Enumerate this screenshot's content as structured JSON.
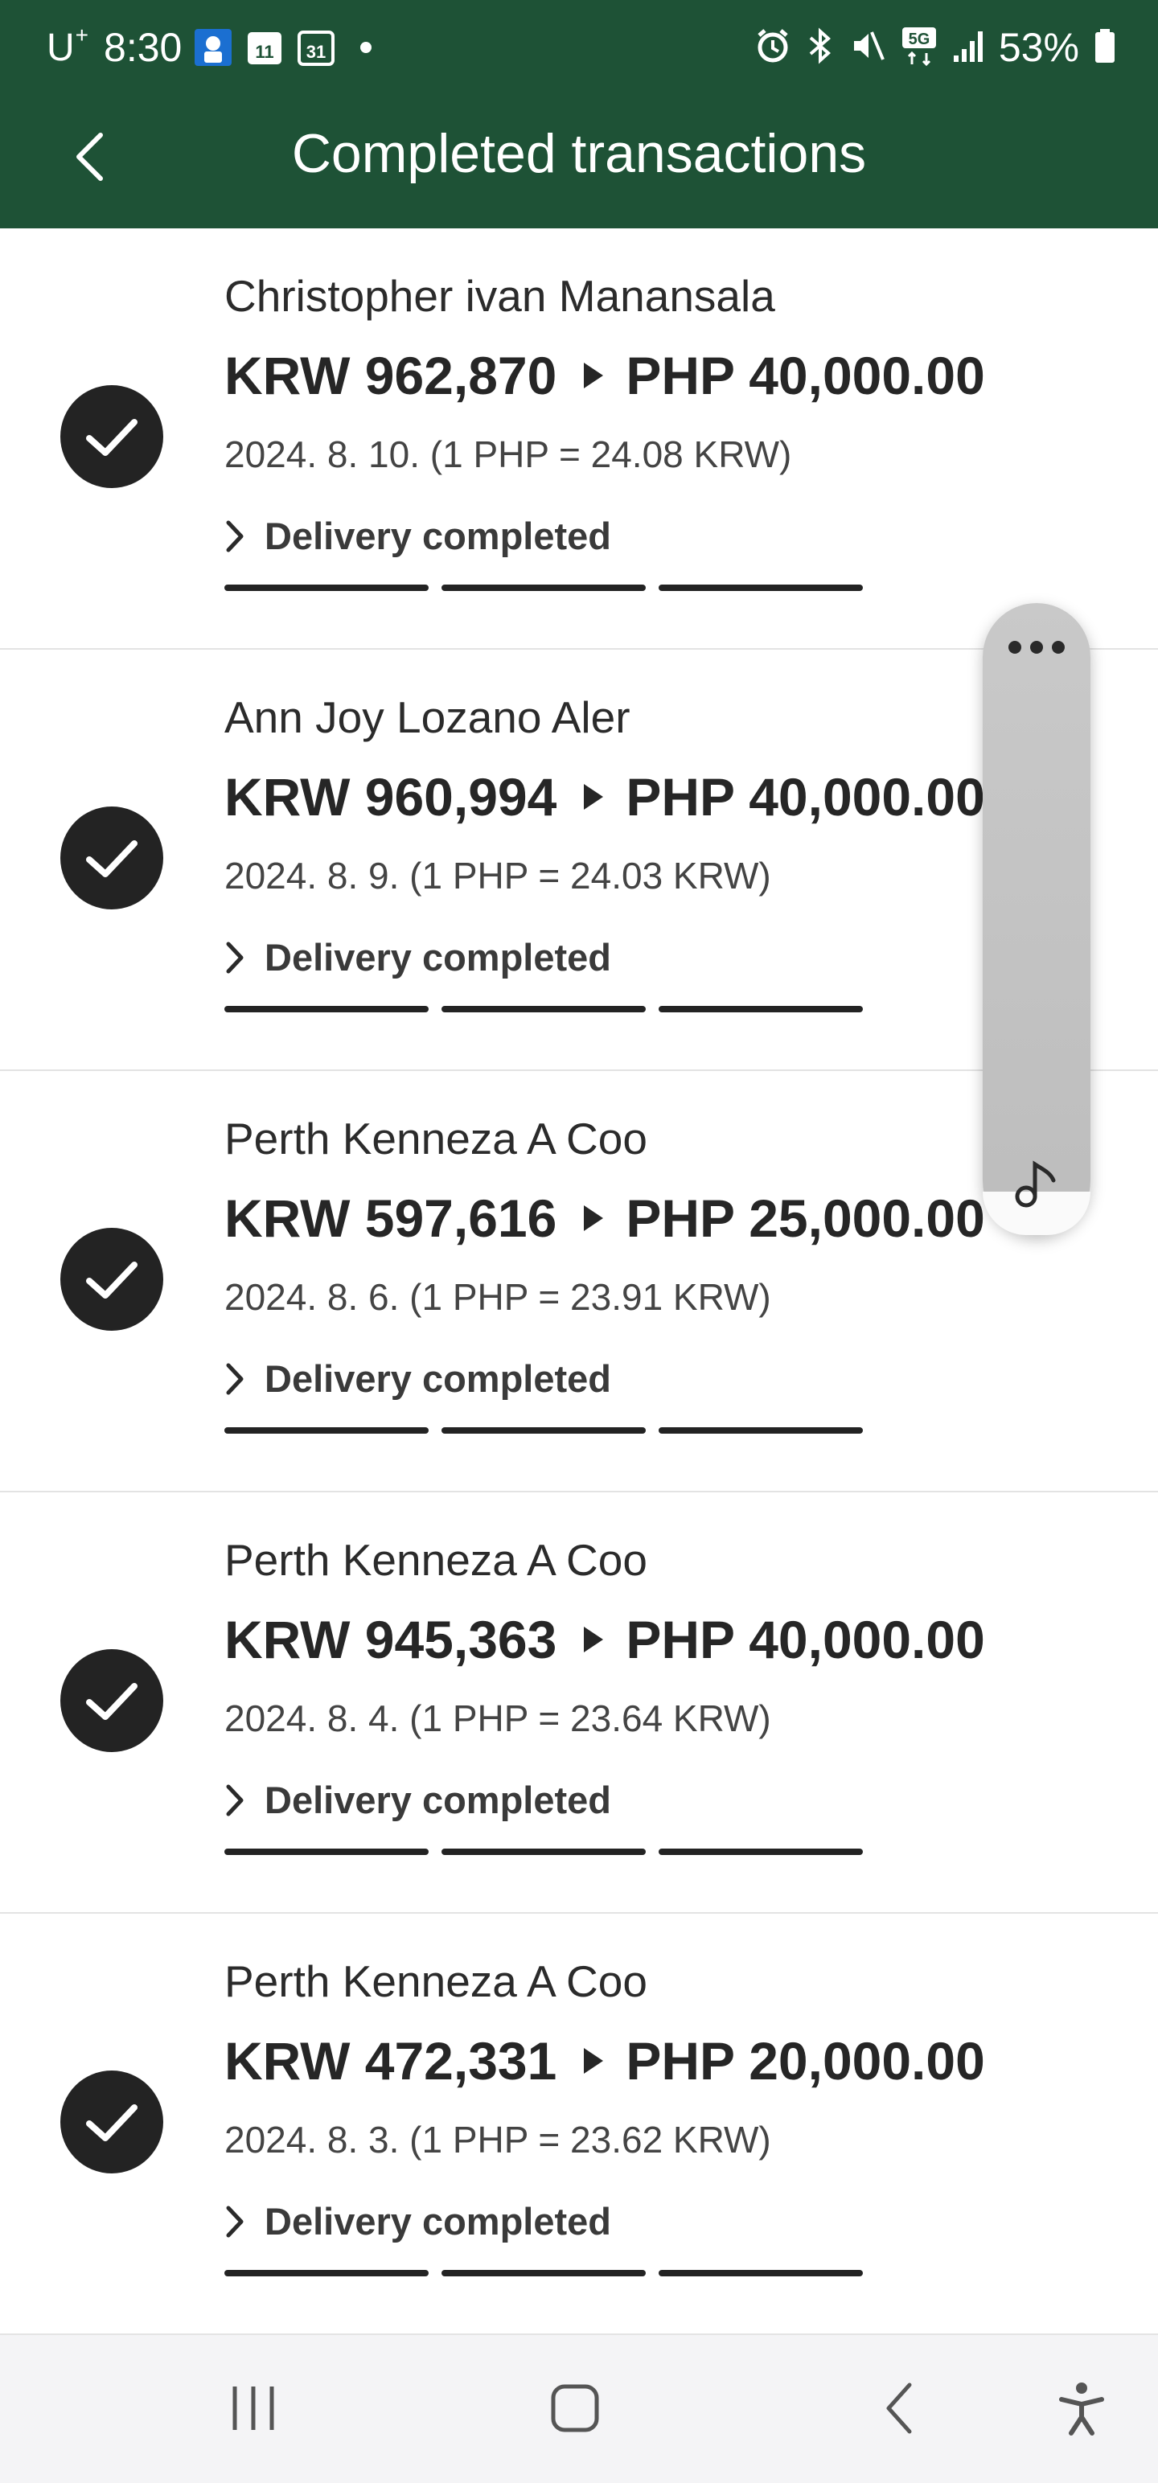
{
  "status_bar": {
    "carrier": "U",
    "carrier_sup": "+",
    "time": "8:30",
    "network": "5G",
    "battery": "53%"
  },
  "app_bar": {
    "title": "Completed transactions",
    "back_icon": "chevron-left-icon"
  },
  "transactions": [
    {
      "name": "Christopher ivan Manansala",
      "send": "KRW 962,870",
      "receive": "PHP 40,000.00",
      "date": "2024. 8. 10. (1 PHP = 24.08 KRW)",
      "status": "Delivery completed"
    },
    {
      "name": "Ann Joy Lozano Aler",
      "send": "KRW 960,994",
      "receive": "PHP 40,000.00",
      "date": "2024. 8. 9. (1 PHP = 24.03 KRW)",
      "status": "Delivery completed"
    },
    {
      "name": "Perth Kenneza A Coo",
      "send": "KRW 597,616",
      "receive": "PHP 25,000.00",
      "date": "2024. 8. 6. (1 PHP = 23.91 KRW)",
      "status": "Delivery completed"
    },
    {
      "name": "Perth Kenneza A Coo",
      "send": "KRW 945,363",
      "receive": "PHP 40,000.00",
      "date": "2024. 8. 4. (1 PHP = 23.64 KRW)",
      "status": "Delivery completed"
    },
    {
      "name": "Perth Kenneza A Coo",
      "send": "KRW 472,331",
      "receive": "PHP 20,000.00",
      "date": "2024. 8. 3. (1 PHP = 23.62 KRW)",
      "status": "Delivery completed"
    }
  ],
  "floating_panel": {
    "icons": [
      "more-horizontal-icon",
      "music-note-icon"
    ]
  },
  "nav_bar": {
    "icons": [
      "recent-apps-icon",
      "home-icon",
      "back-icon",
      "accessibility-icon"
    ]
  },
  "colors": {
    "header": "#1e5236",
    "check_circle": "#232323",
    "progress": "#232323"
  }
}
